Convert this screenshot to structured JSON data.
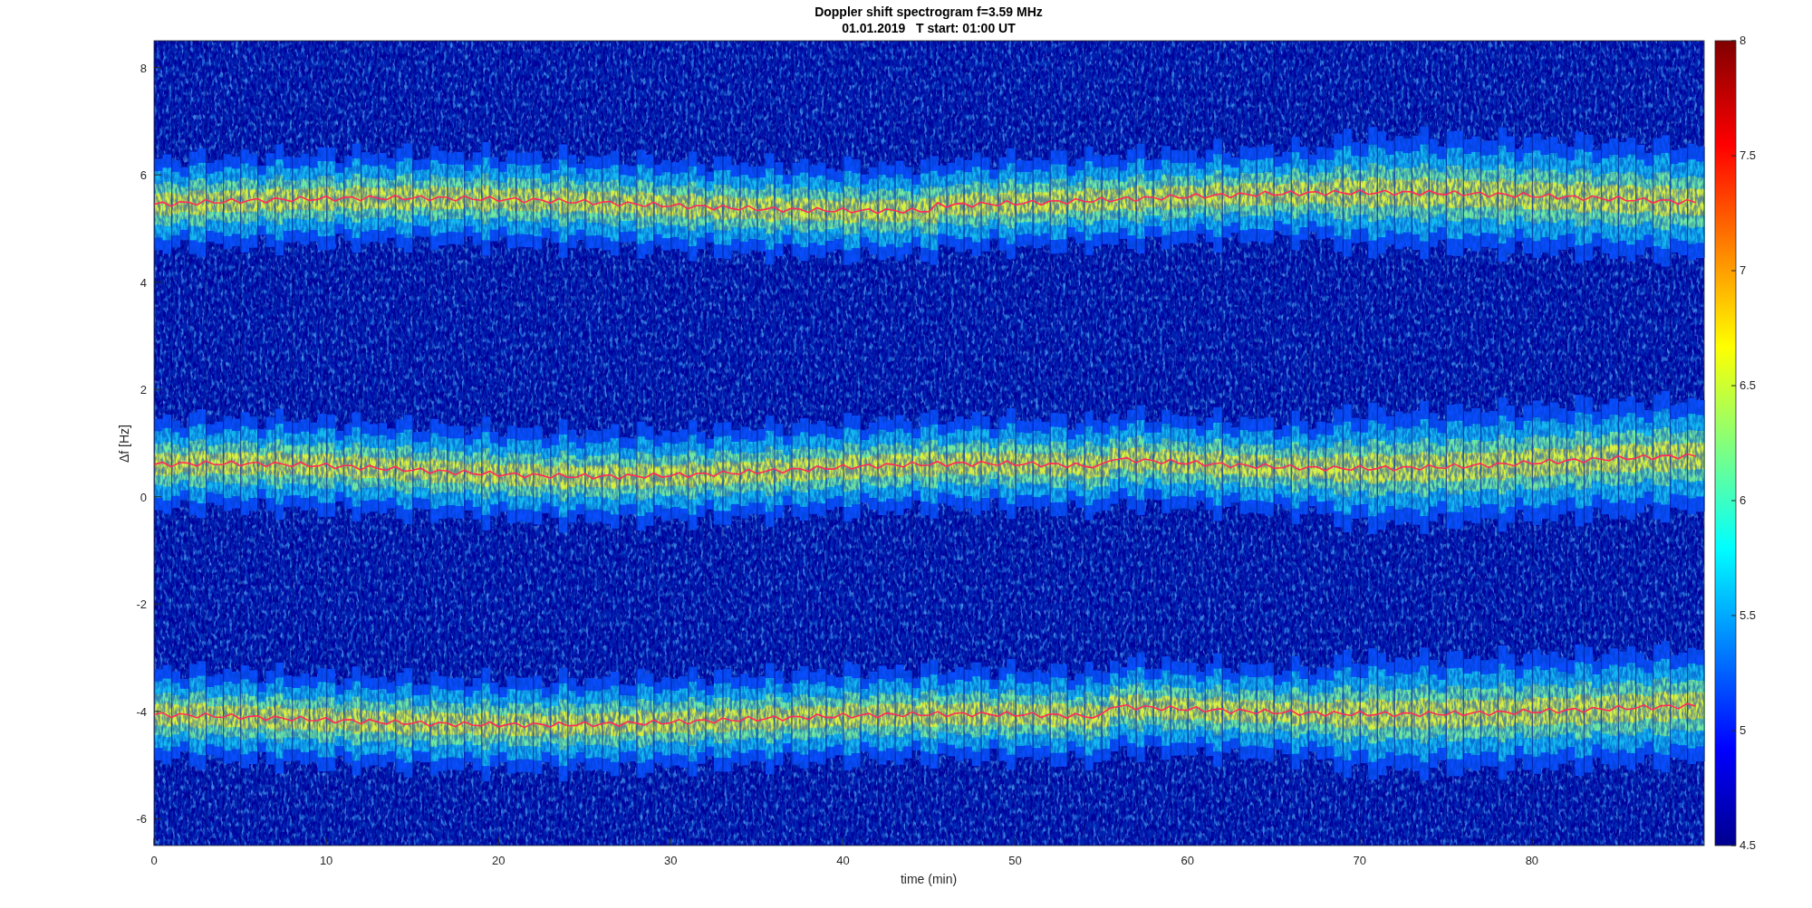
{
  "figure": {
    "title_lines": [
      "Doppler shift spectrogram f=3.59 MHz",
      "01.01.2019   T start: 01:00 UT"
    ],
    "xlabel": "time (min)",
    "ylabel": "Δf [Hz]",
    "xticks": [
      "0",
      "10",
      "20",
      "30",
      "40",
      "50",
      "60",
      "70",
      "80"
    ],
    "yticks": [
      "8",
      "6",
      "4",
      "2",
      "0",
      "-2",
      "-4",
      "-6"
    ],
    "colorbar_ticks": [
      "8",
      "7.5",
      "7",
      "6.5",
      "6",
      "5.5",
      "5",
      "4.5"
    ]
  }
}
